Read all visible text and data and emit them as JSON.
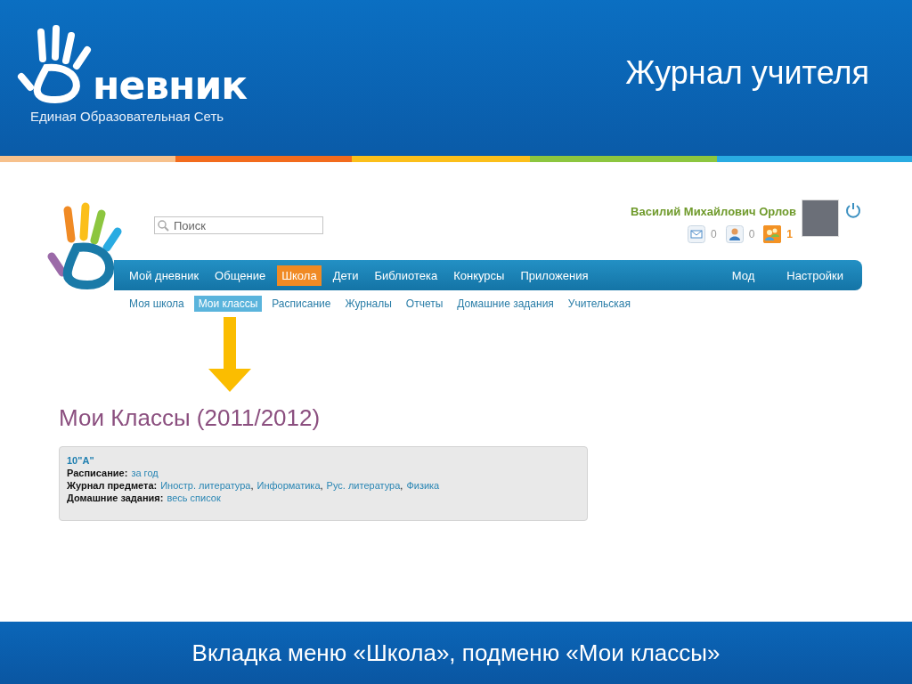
{
  "slide": {
    "logo_text": "невник",
    "logo_subtitle": "Единая Образовательная Сеть",
    "title": "Журнал учителя"
  },
  "site": {
    "search": {
      "placeholder": "Поиск"
    },
    "user": {
      "name": "Василий Михайлович Орлов"
    },
    "counters": [
      {
        "kind": "mail",
        "count": "0",
        "active": false
      },
      {
        "kind": "person",
        "count": "0",
        "active": false
      },
      {
        "kind": "people",
        "count": "1",
        "active": true
      }
    ],
    "menu": [
      {
        "label": "Мой дневник",
        "selected": false
      },
      {
        "label": "Общение",
        "selected": false
      },
      {
        "label": "Школа",
        "selected": true
      },
      {
        "label": "Дети",
        "selected": false
      },
      {
        "label": "Библиотека",
        "selected": false
      },
      {
        "label": "Конкурсы",
        "selected": false
      },
      {
        "label": "Приложения",
        "selected": false
      }
    ],
    "menu_right": [
      {
        "label": "Мод",
        "selected": false
      },
      {
        "label": "Настройки",
        "selected": false
      }
    ],
    "submenu": [
      {
        "label": "Моя школа",
        "selected": false
      },
      {
        "label": "Мои классы",
        "selected": true
      },
      {
        "label": "Расписание",
        "selected": false
      },
      {
        "label": "Журналы",
        "selected": false
      },
      {
        "label": "Отчеты",
        "selected": false
      },
      {
        "label": "Домашние задания",
        "selected": false
      },
      {
        "label": "Учительская",
        "selected": false
      }
    ],
    "heading": "Мои Классы (2011/2012)",
    "class_card": {
      "title": "10\"А\"",
      "rows": [
        {
          "label": "Расписание:",
          "links": [
            {
              "text": "за год"
            }
          ]
        },
        {
          "label": "Журнал предмета:",
          "links": [
            {
              "text": "Иностр. литература",
              "sep": ","
            },
            {
              "text": "Информатика",
              "sep": ","
            },
            {
              "text": "Рус. литература",
              "sep": ","
            },
            {
              "text": "Физика"
            }
          ]
        },
        {
          "label": "Домашние задания:",
          "links": [
            {
              "text": "весь список"
            }
          ]
        }
      ]
    }
  },
  "caption": "Вкладка меню «Школа», подменю «Мои классы»"
}
